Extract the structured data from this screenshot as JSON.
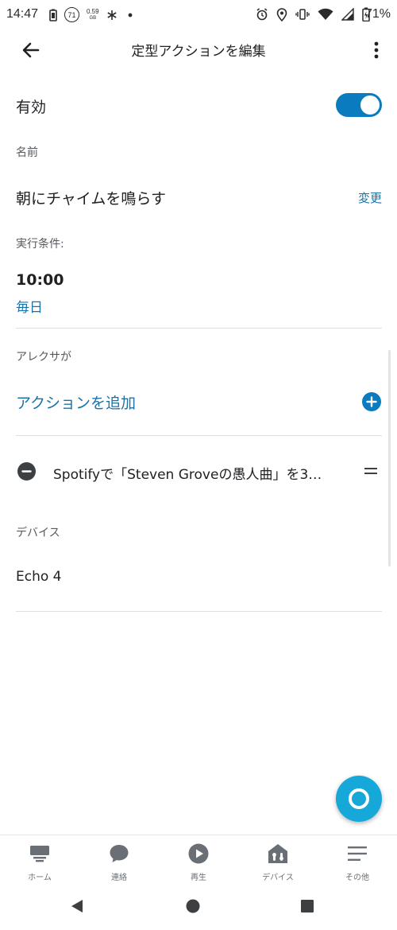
{
  "status_bar": {
    "time": "14:47",
    "notification_badge": "71",
    "net_speed": "0.59",
    "net_speed_unit": "GB",
    "battery_percent": "71%"
  },
  "app_bar": {
    "title": "定型アクションを編集"
  },
  "enabled": {
    "label": "有効",
    "value": true
  },
  "name_section": {
    "label": "名前",
    "value": "朝にチャイムを鳴らす",
    "change_label": "変更"
  },
  "trigger_section": {
    "label": "実行条件:",
    "time": "10:00",
    "repeat": "毎日"
  },
  "actions_section": {
    "label": "アレクサが",
    "add_label": "アクションを追加",
    "items": [
      {
        "text": "Spotifyで「Steven Groveの愚人曲」を3…"
      }
    ]
  },
  "device_section": {
    "label": "デバイス",
    "value": "Echo 4"
  },
  "bottom_nav": {
    "items": [
      {
        "label": "ホーム",
        "icon": "home-icon"
      },
      {
        "label": "連絡",
        "icon": "chat-icon"
      },
      {
        "label": "再生",
        "icon": "play-icon"
      },
      {
        "label": "デバイス",
        "icon": "devices-icon"
      },
      {
        "label": "その他",
        "icon": "menu-icon"
      }
    ]
  },
  "colors": {
    "accent": "#0b7bc0",
    "link": "#1a73a8",
    "fab": "#15a8d8",
    "text": "#202124",
    "muted": "#555a5f"
  }
}
